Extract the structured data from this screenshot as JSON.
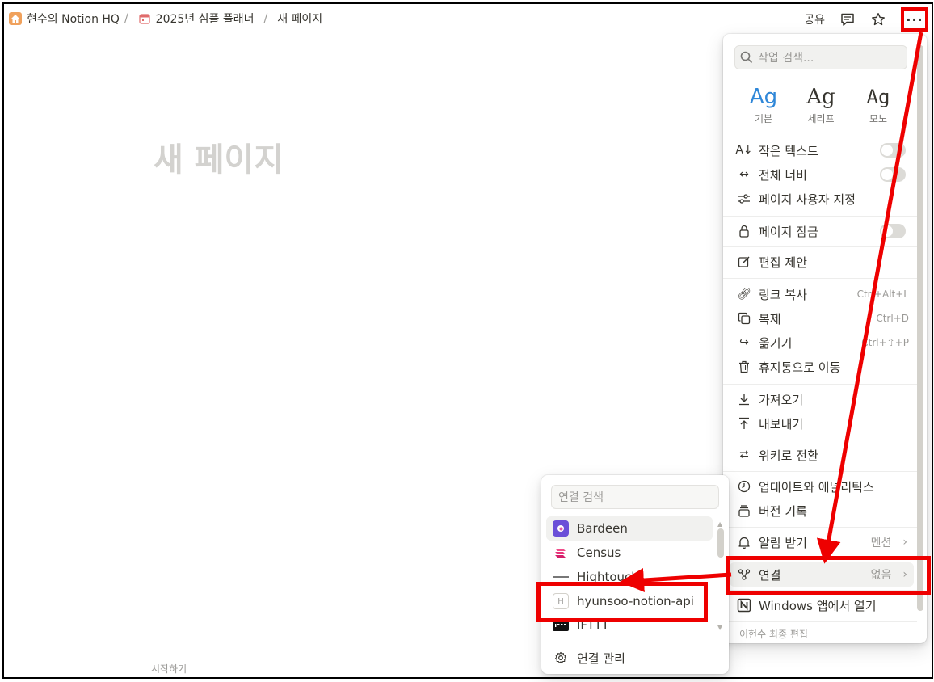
{
  "breadcrumb": {
    "workspace": "현수의 Notion HQ",
    "sep1": "/",
    "planner": "2025년 심플 플래너",
    "sep2": "/",
    "page": "새 페이지"
  },
  "topbar": {
    "share": "공유",
    "more": "···"
  },
  "page": {
    "title": "새 페이지",
    "start_hint": "시작하기"
  },
  "menu": {
    "search_placeholder": "작업 검색...",
    "fonts": [
      {
        "ag": "Ag",
        "label": "기본",
        "selected": true
      },
      {
        "ag": "Ag",
        "label": "세리프",
        "selected": false
      },
      {
        "ag": "Ag",
        "label": "모노",
        "selected": false
      }
    ],
    "small_text": "작은 텍스트",
    "full_width": "전체 너비",
    "customize": "페이지 사용자 지정",
    "lock": "페이지 잠금",
    "suggest": "편집 제안",
    "copy_link": "링크 복사",
    "copy_link_shortcut": "Ctrl+Alt+L",
    "duplicate": "복제",
    "duplicate_shortcut": "Ctrl+D",
    "move": "옮기기",
    "move_shortcut": "Ctrl+⇧+P",
    "trash": "휴지통으로 이동",
    "import": "가져오기",
    "export": "내보내기",
    "wiki": "위키로 전환",
    "analytics": "업데이트와 애널리틱스",
    "history": "버전 기록",
    "notify": "알림 받기",
    "notify_value": "멘션",
    "connections": "연결",
    "connections_value": "없음",
    "open_app": "Windows 앱에서 열기",
    "footer": "이현수 최종 편집"
  },
  "connections_menu": {
    "search_placeholder": "연결 검색",
    "items": [
      {
        "name": "Bardeen"
      },
      {
        "name": "Census"
      },
      {
        "name": "Hightouch"
      },
      {
        "name": "hyunsoo-notion-api"
      },
      {
        "name": "IFTTT"
      }
    ],
    "manage": "연결 관리"
  },
  "colors": {
    "accent": "#2f87d8",
    "annotation": "#e00000"
  }
}
